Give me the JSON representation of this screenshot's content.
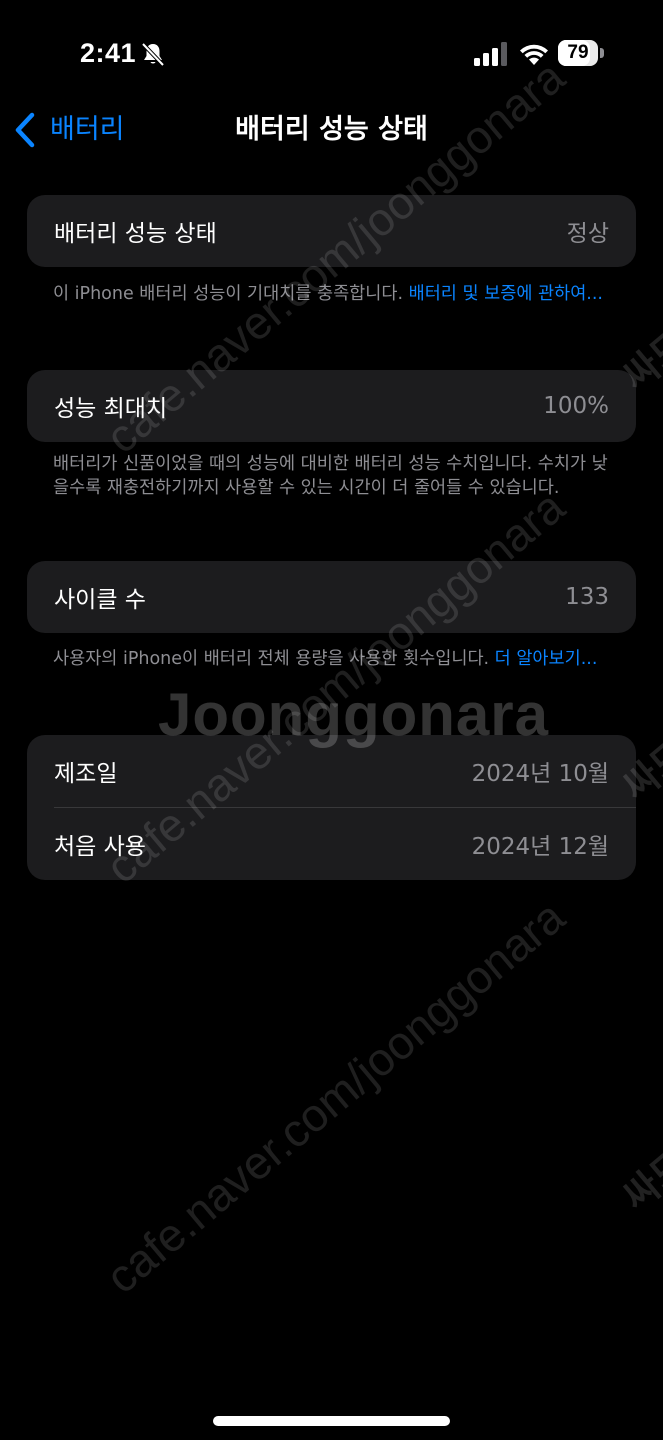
{
  "status_bar": {
    "time": "2:41",
    "battery_level": "79",
    "battery_fraction": 0.79
  },
  "nav": {
    "back_label": "배터리",
    "title": "배터리 성능 상태"
  },
  "sections": {
    "health": {
      "label": "배터리 성능 상태",
      "value": "정상",
      "footnote_text": "이 iPhone 배터리 성능이 기대치를 충족합니다. ",
      "footnote_link": "배터리 및 보증에 관하여..."
    },
    "max_capacity": {
      "label": "성능 최대치",
      "value": "100%",
      "footnote_text": "배터리가 신품이었을 때의 성능에 대비한 배터리 성능 수치입니다. 수치가 낮을수록 재충전하기까지 사용할 수 있는 시간이 더 줄어들 수 있습니다."
    },
    "cycle_count": {
      "label": "사이클 수",
      "value": "133",
      "footnote_text": "사용자의 iPhone이 배터리 전체 용량을 사용한 횟수입니다. ",
      "footnote_link": "더 알아보기..."
    },
    "dates": {
      "manufacture_label": "제조일",
      "manufacture_value": "2024년 10월",
      "first_use_label": "처음 사용",
      "first_use_value": "2024년 12월"
    }
  },
  "watermark": {
    "url": "cafe.naver.com/joonggonara",
    "brand": "Joonggonara",
    "side": "싸드"
  },
  "colors": {
    "background": "#000000",
    "card": "#1c1c1e",
    "accent": "#0a84ff",
    "secondary_text": "#8e8e93"
  },
  "icons": {
    "silent": "bell-slash-icon",
    "signal": "cellular-signal-icon",
    "wifi": "wifi-icon",
    "battery": "battery-icon",
    "back": "chevron-left-icon"
  }
}
